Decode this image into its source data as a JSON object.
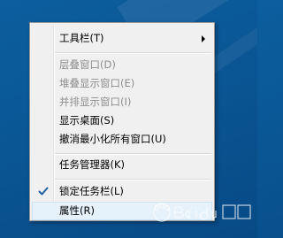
{
  "menu": {
    "items": [
      {
        "label": "工具栏(T)",
        "enabled": true,
        "has_submenu": true
      },
      {
        "label": "层叠窗口(D)",
        "enabled": false
      },
      {
        "label": "堆叠显示窗口(E)",
        "enabled": false
      },
      {
        "label": "并排显示窗口(I)",
        "enabled": false
      },
      {
        "label": "显示桌面(S)",
        "enabled": true
      },
      {
        "label": "撤消最小化所有窗口(U)",
        "enabled": true
      },
      {
        "label": "任务管理器(K)",
        "enabled": true
      },
      {
        "label": "锁定任务栏(L)",
        "enabled": true,
        "checked": true
      },
      {
        "label": "属性(R)",
        "enabled": true,
        "highlighted": true
      }
    ]
  },
  "colors": {
    "desktop": "#0a5796",
    "menu_bg": "#f0f0f0",
    "disabled_text": "#8d8d8d",
    "highlight_bg": "#e5f1fb",
    "check": "#1f5fa8"
  },
  "watermark": {
    "logo_text": "Baidu 经验"
  }
}
